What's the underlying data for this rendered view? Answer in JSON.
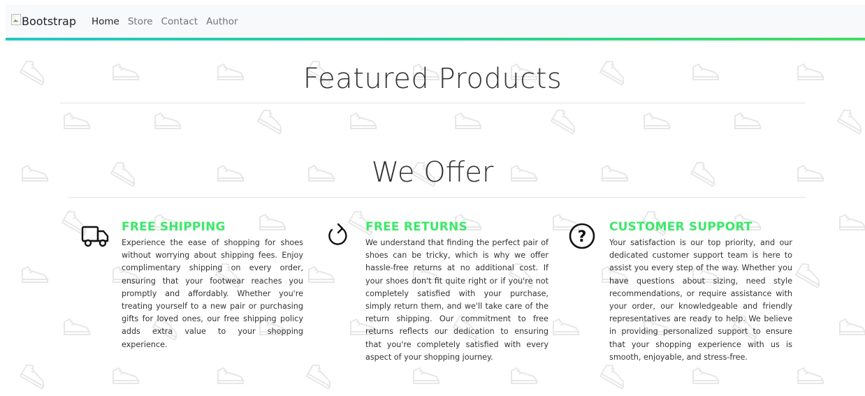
{
  "navbar": {
    "brand": "Bootstrap",
    "links": [
      "Home",
      "Store",
      "Contact",
      "Author"
    ]
  },
  "main": {
    "featured_title": "Featured Products",
    "offer_title": "We Offer",
    "features": [
      {
        "icon": "truck-icon",
        "title": "FREE SHIPPING",
        "text": "Experience the ease of shopping for shoes without worrying about shipping fees. Enjoy complimentary shipping on every order, ensuring that your footwear reaches you promptly and affordably. Whether you're treating yourself to a new pair or purchasing gifts for loved ones, our free shipping policy adds extra value to your shopping experience."
      },
      {
        "icon": "refresh-icon",
        "title": "FREE RETURNS",
        "text": "We understand that finding the perfect pair of shoes can be tricky, which is why we offer hassle-free returns at no additional cost. If your shoes don't fit quite right or if you're not completely satisfied with your purchase, simply return them, and we'll take care of the return shipping. Our commitment to free returns reflects our dedication to ensuring that you're completely satisfied with every aspect of your shopping journey."
      },
      {
        "icon": "question-circle-icon",
        "title": "CUSTOMER SUPPORT",
        "text": "Your satisfaction is our top priority, and our dedicated customer support team is here to assist you every step of the way. Whether you have questions about sizing, need style recommendations, or require assistance with your order, our knowledgeable and friendly representatives are ready to help. We believe in providing personalized support to ensure that your shopping experience with us is smooth, enjoyable, and stress-free."
      }
    ]
  },
  "colors": {
    "accent": "#3de86a",
    "navbar_border": "#2bd0a4"
  }
}
